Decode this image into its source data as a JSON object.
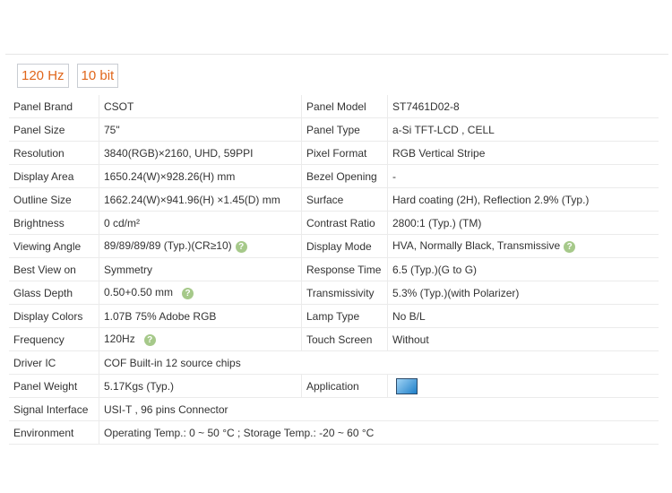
{
  "tags": [
    "120 Hz",
    "10 bit"
  ],
  "rows": [
    {
      "l": "Panel Brand",
      "v": "CSOT",
      "l2": "Panel Model",
      "v2": "ST7461D02-8"
    },
    {
      "l": "Panel Size",
      "v": "75\"",
      "l2": "Panel Type",
      "v2": "a-Si TFT-LCD , CELL"
    },
    {
      "l": "Resolution",
      "v": "3840(RGB)×2160, UHD, 59PPI",
      "l2": "Pixel Format",
      "v2": "RGB Vertical Stripe"
    },
    {
      "l": "Display Area",
      "v": "1650.24(W)×928.26(H) mm",
      "l2": "Bezel Opening",
      "v2": "-"
    },
    {
      "l": "Outline Size",
      "v": "1662.24(W)×941.96(H) ×1.45(D) mm",
      "l2": "Surface",
      "v2": "Hard coating (2H), Reflection 2.9% (Typ.)"
    },
    {
      "l": "Brightness",
      "v": "0 cd/m²",
      "l2": "Contrast Ratio",
      "v2": "2800:1 (Typ.) (TM)"
    },
    {
      "l": "Viewing Angle",
      "v": "89/89/89/89 (Typ.)(CR≥10)",
      "l2": "Display Mode",
      "v2": "HVA, Normally Black, Transmissive"
    },
    {
      "l": "Best View on",
      "v": "Symmetry",
      "l2": "Response Time",
      "v2": "6.5 (Typ.)(G to G)"
    },
    {
      "l": "Glass Depth",
      "v": "0.50+0.50 mm",
      "l2": "Transmissivity",
      "v2": "5.3% (Typ.)(with Polarizer)"
    },
    {
      "l": "Display Colors",
      "v": "1.07B   75% Adobe RGB",
      "l2": "Lamp Type",
      "v2": "No B/L"
    },
    {
      "l": "Frequency",
      "v": "120Hz",
      "l2": "Touch Screen",
      "v2": "Without"
    },
    {
      "l": "Driver IC",
      "v": "COF Built-in 12 source chips",
      "l2": "",
      "v2": ""
    },
    {
      "l": "Panel Weight",
      "v": "5.17Kgs (Typ.)",
      "l2": "Application",
      "v2": ""
    },
    {
      "l": "Signal Interface",
      "v": "USI-T , 96 pins Connector",
      "l2": "",
      "v2": ""
    },
    {
      "l": "Environment",
      "v": "Operating Temp.: 0 ~ 50 °C ; Storage Temp.: -20 ~ 60 °C",
      "l2": "",
      "v2": ""
    }
  ],
  "help_icon": "?",
  "application_icon": "tv-icon"
}
